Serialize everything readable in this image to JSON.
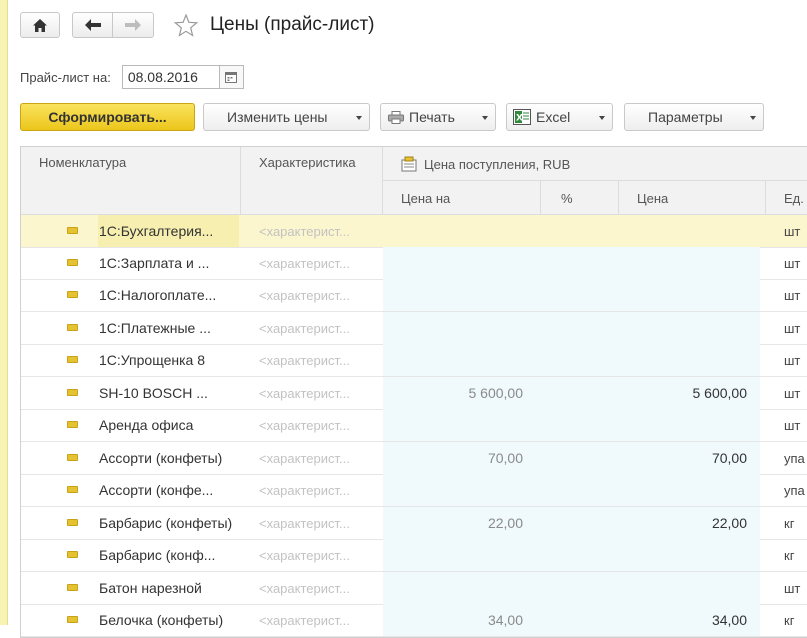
{
  "window": {
    "title": "Цены (прайс-лист)"
  },
  "filter": {
    "label": "Прайс-лист на:",
    "date": "08.08.2016"
  },
  "toolbar": {
    "generate": "Сформировать...",
    "change_prices": "Изменить цены",
    "print": "Печать",
    "excel": "Excel",
    "params": "Параметры"
  },
  "table": {
    "headers": {
      "nomenclature": "Номенклатура",
      "characteristic": "Характеристика",
      "price_group": "Цена поступления, RUB",
      "price_on": "Цена на",
      "percent": "%",
      "price": "Цена",
      "unit": "Ед."
    },
    "rows": [
      {
        "name": "1С:Бухгалтерия...",
        "char": "<характерист...",
        "price_on": "",
        "price": "",
        "unit": "шт"
      },
      {
        "name": "1С:Зарплата и ...",
        "char": "<характерист...",
        "price_on": "",
        "price": "",
        "unit": "шт"
      },
      {
        "name": "1С:Налогоплате...",
        "char": "<характерист...",
        "price_on": "",
        "price": "",
        "unit": "шт"
      },
      {
        "name": "1С:Платежные ...",
        "char": "<характерист...",
        "price_on": "",
        "price": "",
        "unit": "шт"
      },
      {
        "name": "1С:Упрощенка 8",
        "char": "<характерист...",
        "price_on": "",
        "price": "",
        "unit": "шт"
      },
      {
        "name": "SH-10 BOSCH ...",
        "char": "<характерист...",
        "price_on": "5 600,00",
        "price": "5 600,00",
        "unit": "шт"
      },
      {
        "name": "Аренда офиса",
        "char": "<характерист...",
        "price_on": "",
        "price": "",
        "unit": "шт"
      },
      {
        "name": "Ассорти (конфеты)",
        "char": "<характерист...",
        "price_on": "70,00",
        "price": "70,00",
        "unit": "упа"
      },
      {
        "name": "Ассорти (конфе...",
        "char": "<характерист...",
        "price_on": "",
        "price": "",
        "unit": "упа"
      },
      {
        "name": "Барбарис (конфеты)",
        "char": "<характерист...",
        "price_on": "22,00",
        "price": "22,00",
        "unit": "кг"
      },
      {
        "name": "Барбарис (конф...",
        "char": "<характерист...",
        "price_on": "",
        "price": "",
        "unit": "кг"
      },
      {
        "name": "Батон нарезной",
        "char": "<характерист...",
        "price_on": "",
        "price": "",
        "unit": "шт"
      },
      {
        "name": "Белочка (конфеты)",
        "char": "<характерист...",
        "price_on": "34,00",
        "price": "34,00",
        "unit": "кг"
      }
    ]
  }
}
